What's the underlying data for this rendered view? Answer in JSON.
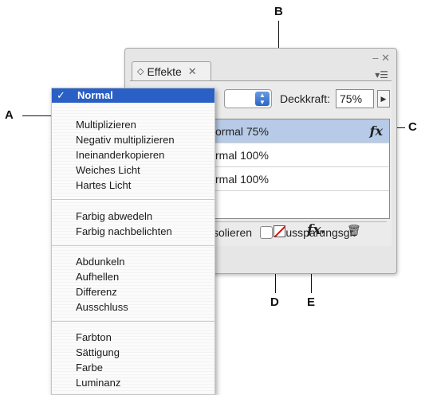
{
  "callouts": {
    "a": "A",
    "b": "B",
    "c": "C",
    "d": "D",
    "e": "E"
  },
  "panel": {
    "tab_label": "Effekte",
    "blend_value": "",
    "opacity_label": "Deckkraft:",
    "opacity_value": "75%",
    "effects": [
      {
        "label": "ormal 75%",
        "has_fx": true,
        "selected": true
      },
      {
        "label": "rmal 100%",
        "has_fx": false,
        "selected": false
      },
      {
        "label": "rmal 100%",
        "has_fx": false,
        "selected": false
      }
    ],
    "fx_mark": "fx",
    "isolate_label": "solieren",
    "knockout_label": "Aussparungsgr.",
    "fx_button_label": "fx"
  },
  "menu": {
    "selected": "Normal",
    "groups": [
      [
        "Multiplizieren",
        "Negativ multiplizieren",
        "Ineinanderkopieren",
        "Weiches Licht",
        "Hartes Licht"
      ],
      [
        "Farbig abwedeln",
        "Farbig nachbelichten"
      ],
      [
        "Abdunkeln",
        "Aufhellen",
        "Differenz",
        "Ausschluss"
      ],
      [
        "Farbton",
        "Sättigung",
        "Farbe",
        "Luminanz"
      ]
    ]
  },
  "icons": {
    "check": "check-icon",
    "close": "close-icon",
    "panel_menu": "panel-menu-icon",
    "stepper": "stepper-icon",
    "arrow": "arrow-right-icon",
    "clear": "clear-effects-icon",
    "fx": "fx-icon",
    "trash": "trash-icon"
  },
  "colors": {
    "menu_highlight": "#2a5fc5",
    "row_selected": "#b7cbe8"
  }
}
